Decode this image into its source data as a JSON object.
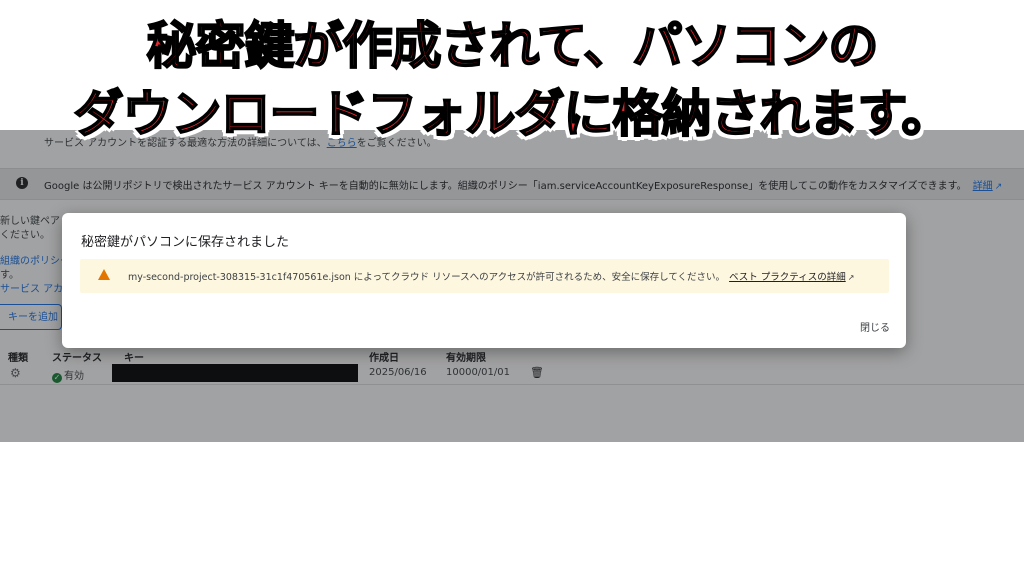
{
  "banner": {
    "line1": "秘密鍵が作成されて、パソコンの",
    "line2": "ダウンロードフォルダに格納されます。"
  },
  "page": {
    "intro": "サービス アカウントを認証する最適な方法の詳細については、",
    "intro_link": "こちら",
    "intro_tail": "をご覧ください。",
    "info_icon": "info-icon",
    "info_text": "Google は公開リポジトリで検出されたサービス アカウント キーを自動的に無効にします。組織のポリシー「iam.serviceAccountKeyExposureResponse」を使用してこの動作をカスタマイズできます。",
    "info_link": "詳細",
    "side_line1": "新しい鍵ペア",
    "side_line2": "ください。",
    "side_link": "組織のポリシー",
    "side_line3": "す。",
    "side_link2": "サービス アカウ",
    "add_key_label": "キーを追加",
    "table": {
      "headers": [
        "種類",
        "ステータス",
        "キー",
        "作成日",
        "有効期限"
      ],
      "row": {
        "status": "有効",
        "created": "2025/06/16",
        "expires": "10000/01/01"
      }
    }
  },
  "dialog": {
    "title": "秘密鍵がパソコンに保存されました",
    "warning": "my-second-project-308315-31c1f470561e.json によってクラウド リソースへのアクセスが許可されるため、安全に保存してください。",
    "warning_link": "ベスト プラクティスの詳細",
    "close_label": "閉じる"
  },
  "colors": {
    "banner_text": "#e8262c",
    "accent": "#1a73e8",
    "warning": "#e37400"
  }
}
